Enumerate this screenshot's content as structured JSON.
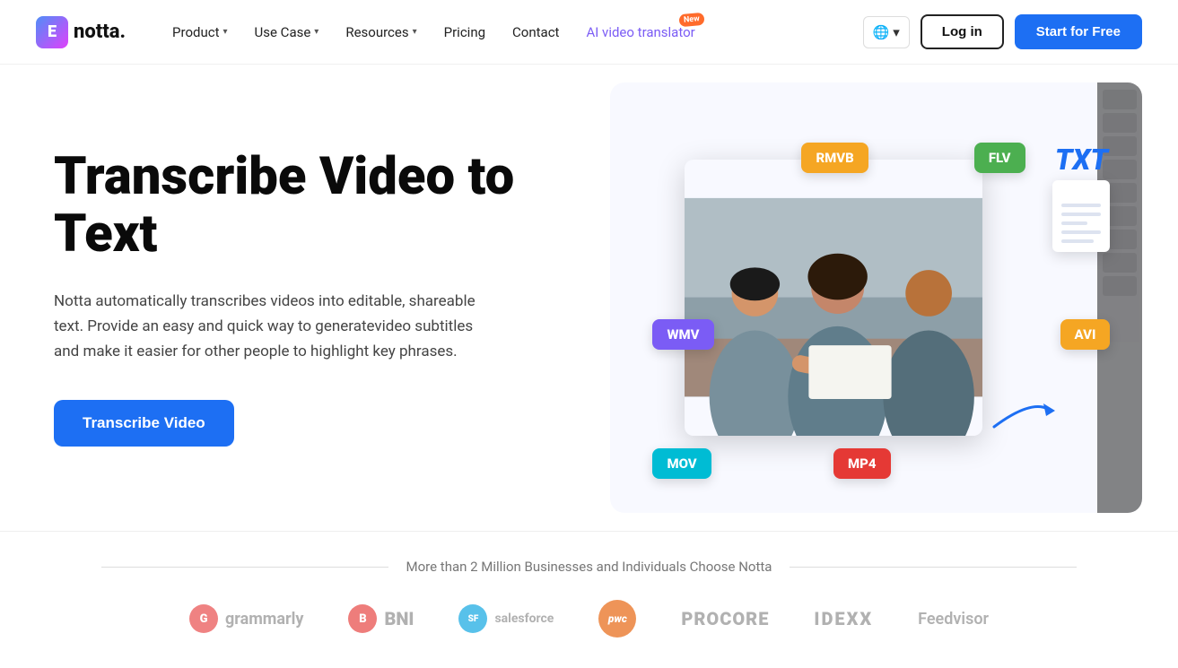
{
  "nav": {
    "logo_letter": "E",
    "logo_name": "notta.",
    "items": [
      {
        "label": "Product",
        "has_dropdown": true
      },
      {
        "label": "Use Case",
        "has_dropdown": true
      },
      {
        "label": "Resources",
        "has_dropdown": true
      },
      {
        "label": "Pricing",
        "has_dropdown": false
      },
      {
        "label": "Contact",
        "has_dropdown": false
      }
    ],
    "ai_label": "AI video translator",
    "ai_badge": "New",
    "globe_icon": "🌐",
    "globe_chevron": "▾",
    "login_label": "Log in",
    "start_label": "Start for Free"
  },
  "hero": {
    "title": "Transcribe Video to Text",
    "description": "Notta automatically transcribes videos into editable, shareable text. Provide an easy and quick way to generatevideo subtitles and make it easier for other people to highlight key phrases.",
    "cta_label": "Transcribe Video",
    "format_tags": [
      {
        "label": "WMV",
        "pos": "wmv"
      },
      {
        "label": "RMVB",
        "pos": "rmvb"
      },
      {
        "label": "FLV",
        "pos": "flv"
      },
      {
        "label": "AVI",
        "pos": "avi"
      },
      {
        "label": "MOV",
        "pos": "mov"
      },
      {
        "label": "MP4",
        "pos": "mp4"
      }
    ],
    "output_label": "TXT"
  },
  "social": {
    "tagline": "More than 2 Million Businesses and Individuals Choose Notta",
    "companies": [
      {
        "name": "grammarly",
        "display": "grammarly"
      },
      {
        "name": "BNI",
        "display": "BNI"
      },
      {
        "name": "salesforce",
        "display": "salesforce"
      },
      {
        "name": "pwc",
        "display": "pwc"
      },
      {
        "name": "PROCORE",
        "display": "PROCORE"
      },
      {
        "name": "IDEXX",
        "display": "IDEXX"
      },
      {
        "name": "Feedvisor",
        "display": "Feedvisor"
      }
    ]
  }
}
